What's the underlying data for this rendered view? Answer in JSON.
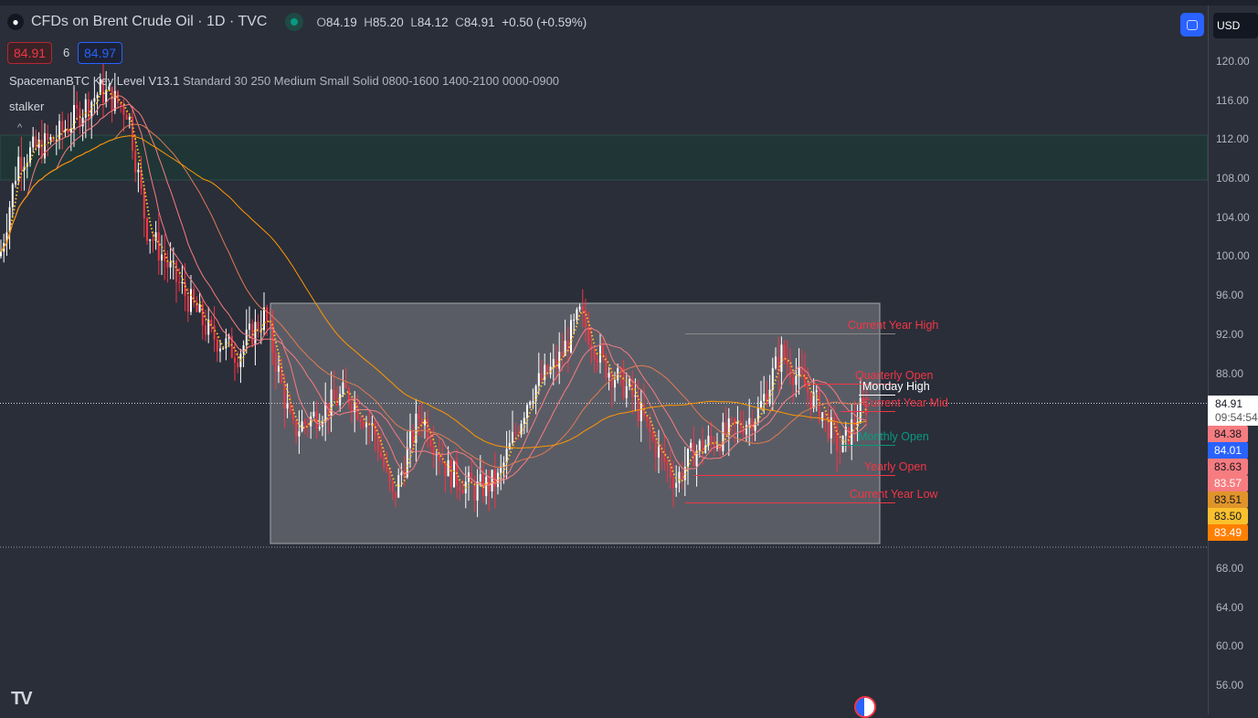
{
  "header": {
    "symbol_title": "CFDs on Brent Crude Oil · 1D · TVC",
    "open_label": "O",
    "open": "84.19",
    "high_label": "H",
    "high": "85.20",
    "low_label": "L",
    "low": "84.12",
    "close_label": "C",
    "close": "84.91",
    "change": "+0.50 (+0.59%)"
  },
  "trade": {
    "sell_price": "84.91",
    "spread": "6",
    "buy_price": "84.97"
  },
  "indicators": {
    "name": "SpacemanBTC Key Level V13.1",
    "params": "Standard 30 250 Medium Small Solid 0800-1600 1400-2100 0000-0900",
    "second": "stalker"
  },
  "currency": "USD",
  "price_axis": {
    "ticks": [
      "120.00",
      "116.00",
      "112.00",
      "108.00",
      "104.00",
      "100.00",
      "96.00",
      "92.00",
      "88.00",
      "68.00",
      "64.00",
      "60.00",
      "56.00"
    ],
    "labels": [
      {
        "v": "84.38",
        "bg": "#f77c80",
        "fg": "#131722"
      },
      {
        "v": "84.01",
        "bg": "#2962ff",
        "fg": "#ffffff"
      },
      {
        "v": "83.63",
        "bg": "#f77c80",
        "fg": "#131722"
      },
      {
        "v": "83.57",
        "bg": "#f77c80",
        "fg": "#ffffff"
      },
      {
        "v": "83.51",
        "bg": "#e0952a",
        "fg": "#131722"
      },
      {
        "v": "83.50",
        "bg": "#fbc02d",
        "fg": "#131722"
      },
      {
        "v": "83.49",
        "bg": "#ff8000",
        "fg": "#ffffff"
      }
    ],
    "last_price": "84.91",
    "countdown": "09:54:54"
  },
  "levels": [
    {
      "label": "Current Year High",
      "color": "#f23645"
    },
    {
      "label": "Quarterly Open",
      "color": "#f23645"
    },
    {
      "label": "Monday High",
      "color": "#ffffff"
    },
    {
      "label": "Current Year Mid",
      "color": "#f23645"
    },
    {
      "label": "Monthly Open",
      "color": "#089981"
    },
    {
      "label": "Yearly Open",
      "color": "#f23645"
    },
    {
      "label": "Current Year Low",
      "color": "#f23645"
    }
  ],
  "chart_data": {
    "type": "candlestick",
    "keypoints": [
      [
        0,
        100
      ],
      [
        20,
        110
      ],
      [
        60,
        112
      ],
      [
        110,
        117
      ],
      [
        140,
        115
      ],
      [
        160,
        103
      ],
      [
        190,
        98
      ],
      [
        230,
        92
      ],
      [
        260,
        90
      ],
      [
        290,
        94
      ],
      [
        320,
        82
      ],
      [
        350,
        84
      ],
      [
        380,
        86
      ],
      [
        410,
        82
      ],
      [
        430,
        75
      ],
      [
        460,
        84
      ],
      [
        490,
        78
      ],
      [
        520,
        76
      ],
      [
        545,
        77
      ],
      [
        580,
        86
      ],
      [
        610,
        89
      ],
      [
        635,
        94
      ],
      [
        660,
        89
      ],
      [
        690,
        86
      ],
      [
        720,
        80
      ],
      [
        740,
        77
      ],
      [
        760,
        80
      ],
      [
        800,
        82
      ],
      [
        830,
        84
      ],
      [
        855,
        90
      ],
      [
        870,
        88
      ],
      [
        900,
        84
      ],
      [
        920,
        80
      ],
      [
        940,
        84
      ],
      [
        950,
        84.91
      ]
    ],
    "ylim": [
      53,
      123
    ]
  }
}
